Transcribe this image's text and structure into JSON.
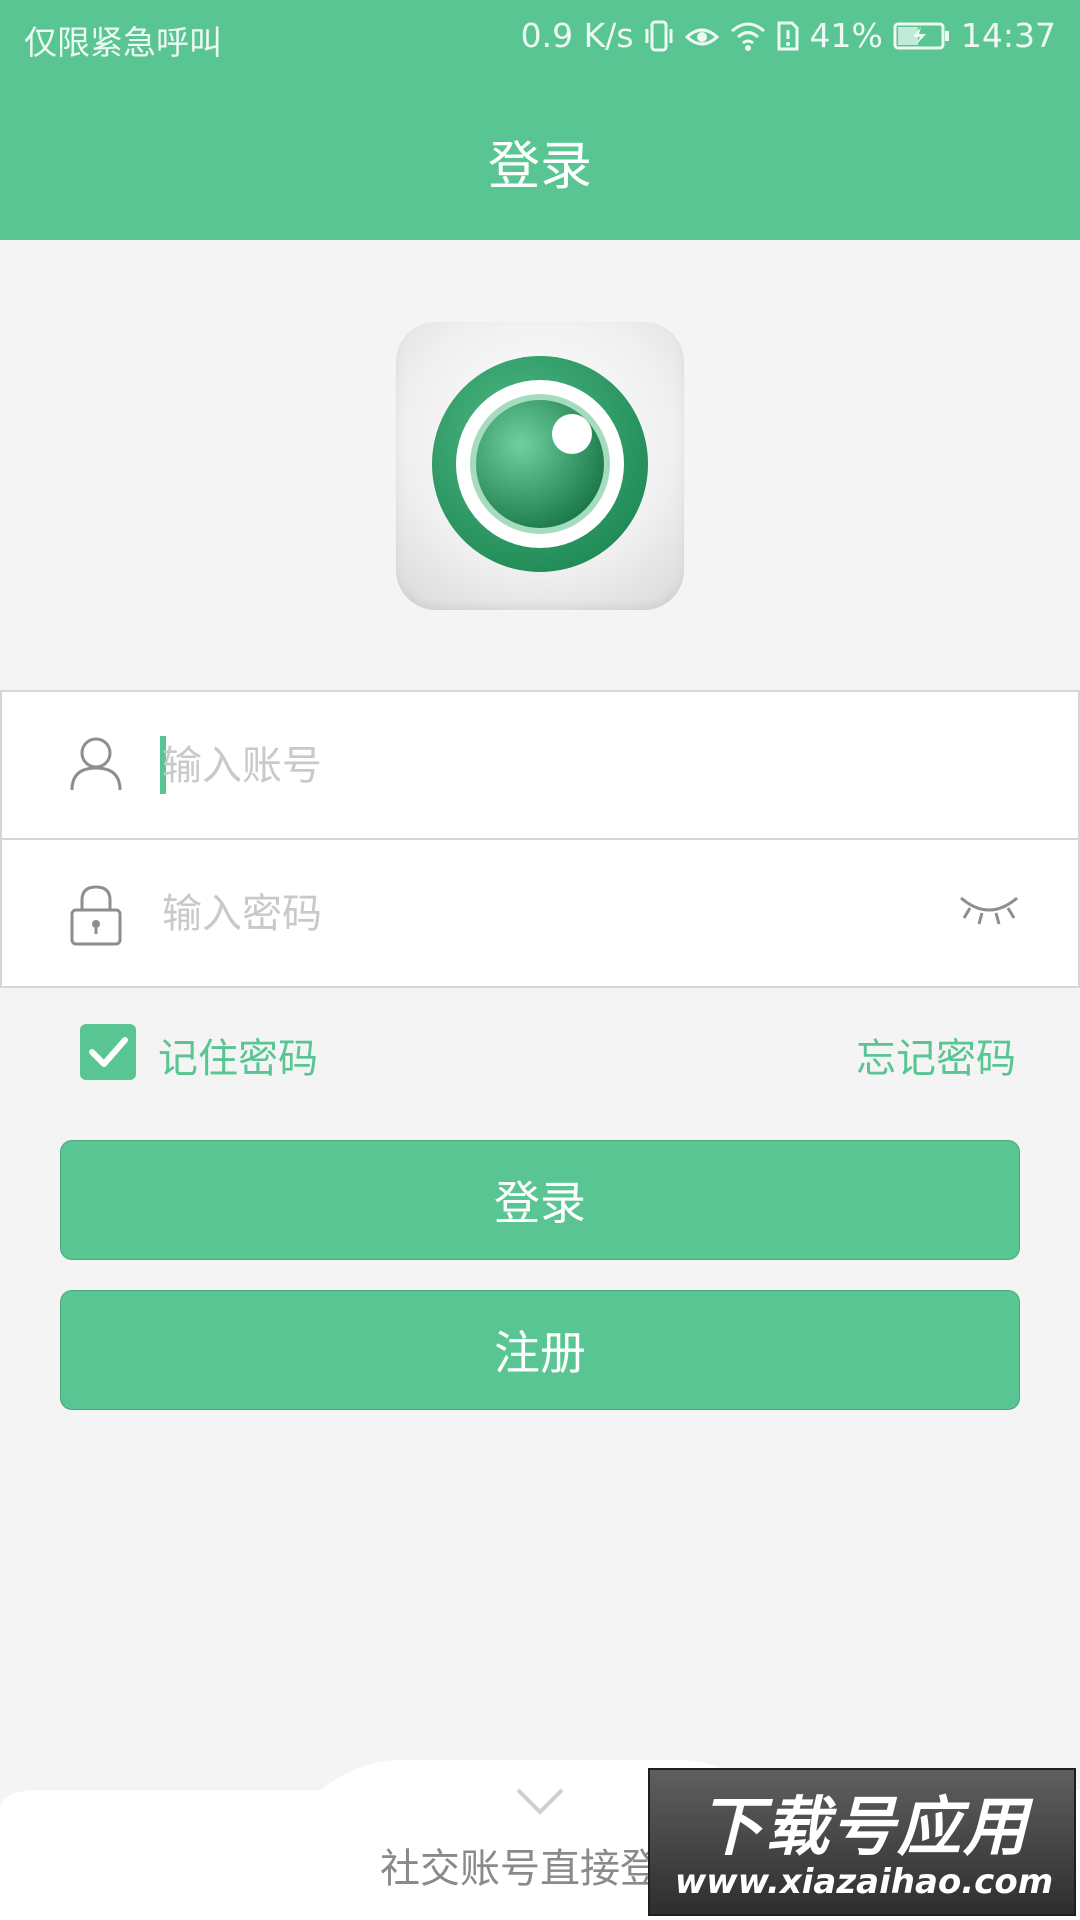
{
  "status_bar": {
    "carrier": "仅限紧急呼叫",
    "speed": "0.9 K/s",
    "battery": "41%",
    "time": "14:37"
  },
  "header": {
    "title": "登录"
  },
  "form": {
    "account_placeholder": "输入账号",
    "password_placeholder": "输入密码"
  },
  "options": {
    "remember_label": "记住密码",
    "remember_checked": true,
    "forgot_label": "忘记密码"
  },
  "buttons": {
    "login_label": "登录",
    "register_label": "注册"
  },
  "social": {
    "label": "社交账号直接登录"
  },
  "watermark": {
    "title": "下载号应用",
    "url": "www.xiazaihao.com"
  },
  "colors": {
    "accent": "#58c592",
    "background": "#f4f4f4",
    "placeholder": "#c9c9c9"
  },
  "icons": [
    "user-icon",
    "lock-icon",
    "eye-closed-icon",
    "check-icon",
    "chevron-down-icon",
    "app-logo-icon"
  ]
}
